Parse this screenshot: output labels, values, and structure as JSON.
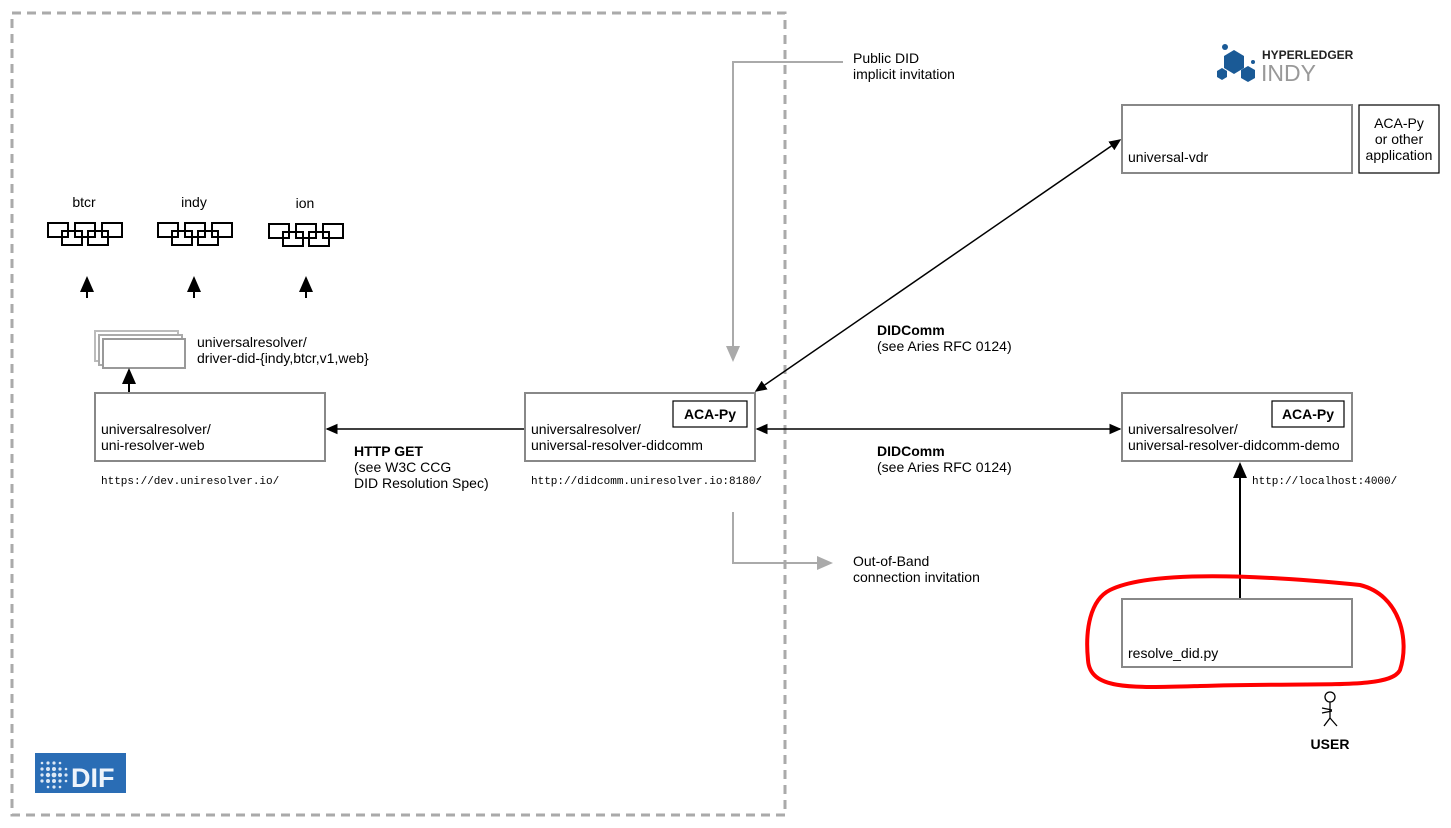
{
  "drivers": [
    {
      "label": "btcr"
    },
    {
      "label": "indy"
    },
    {
      "label": "ion"
    }
  ],
  "driver_stack": {
    "line1": "universalresolver/",
    "line2": "driver-did-{indy,btcr,v1,web}"
  },
  "uni_resolver_web": {
    "line1": "universalresolver/",
    "line2": "uni-resolver-web",
    "url": "https://dev.uniresolver.io/"
  },
  "http_get": {
    "title": "HTTP GET",
    "line1": "(see W3C CCG",
    "line2": "DID Resolution Spec)"
  },
  "didcomm_resolver": {
    "badge": "ACA-Py",
    "line1": "universalresolver/",
    "line2": "universal-resolver-didcomm",
    "url": "http://didcomm.uniresolver.io:8180/"
  },
  "public_did": {
    "line1": "Public DID",
    "line2": "implicit invitation"
  },
  "oob": {
    "line1": "Out-of-Band",
    "line2": "connection invitation"
  },
  "logo_hyperledger": {
    "line1": "HYPERLEDGER",
    "line2": "INDY",
    "color": "#1a5a96"
  },
  "vdr": {
    "label": "universal-vdr",
    "side_line1": "ACA-Py",
    "side_line2": "or other",
    "side_line3": "application"
  },
  "didcomm_upper": {
    "title": "DIDComm",
    "sub": "(see Aries RFC 0124)"
  },
  "didcomm_lower": {
    "title": "DIDComm",
    "sub": "(see Aries RFC 0124)"
  },
  "demo": {
    "badge": "ACA-Py",
    "line1": "universalresolver/",
    "line2": "universal-resolver-didcomm-demo",
    "url": "http://localhost:4000/"
  },
  "resolve": {
    "label": "resolve_did.py",
    "highlight_color": "#ff0000"
  },
  "user": {
    "label": "USER"
  },
  "logo_dif": {
    "text": "DIF",
    "color": "#2a6db5"
  }
}
